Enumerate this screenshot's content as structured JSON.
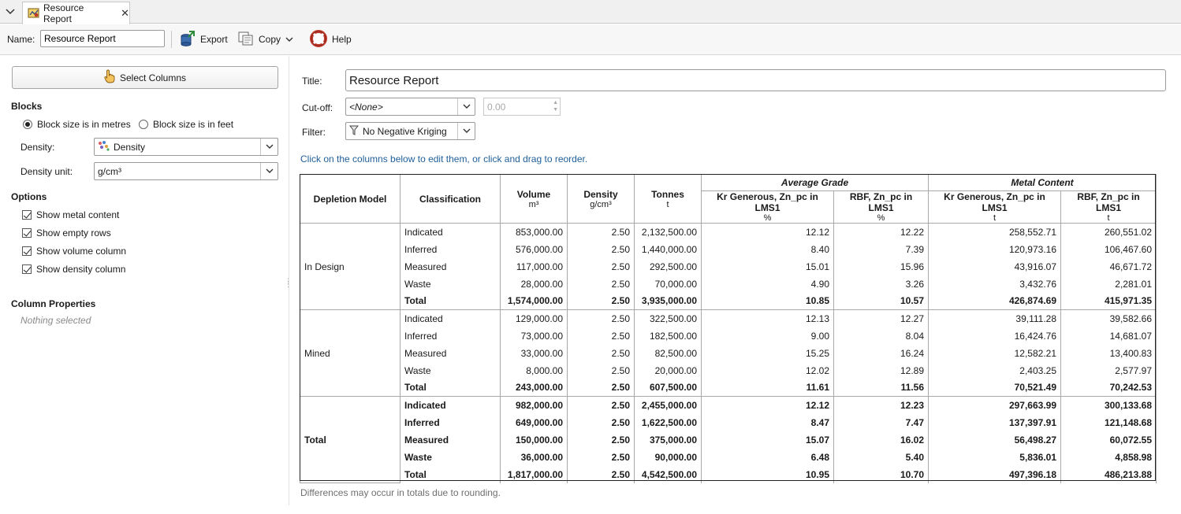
{
  "tab": {
    "label": "Resource Report",
    "close": "✕"
  },
  "toolbar": {
    "name_label": "Name:",
    "name_value": "Resource Report",
    "export_label": "Export",
    "copy_label": "Copy",
    "help_label": "Help"
  },
  "left": {
    "select_columns": "Select Columns",
    "blocks_heading": "Blocks",
    "radio_metres": "Block size is in metres",
    "radio_feet": "Block size is in feet",
    "density_label": "Density:",
    "density_value": "Density",
    "density_unit_label": "Density unit:",
    "density_unit_value": "g/cm³",
    "options_heading": "Options",
    "options": [
      "Show metal content",
      "Show empty rows",
      "Show volume column",
      "Show density column"
    ],
    "column_props_heading": "Column Properties",
    "nothing_selected": "Nothing selected"
  },
  "right": {
    "title_label": "Title:",
    "title_value": "Resource Report",
    "cutoff_label": "Cut-off:",
    "cutoff_value": "<None>",
    "cutoff_number": "0.00",
    "filter_label": "Filter:",
    "filter_value": "No Negative Kriging",
    "hint": "Click on the columns below to edit them, or click and drag to reorder.",
    "footnote": "Differences may occur in totals due to rounding."
  },
  "table": {
    "group_headers": {
      "avg_grade": "Average Grade",
      "metal_content": "Metal Content"
    },
    "columns": [
      {
        "name": "Depletion Model",
        "unit": ""
      },
      {
        "name": "Classification",
        "unit": ""
      },
      {
        "name": "Volume",
        "unit": "m³"
      },
      {
        "name": "Density",
        "unit": "g/cm³"
      },
      {
        "name": "Tonnes",
        "unit": "t"
      },
      {
        "name": "Kr Generous, Zn_pc in LMS1",
        "unit": "%"
      },
      {
        "name": "RBF, Zn_pc in LMS1",
        "unit": "%"
      },
      {
        "name": "Kr Generous, Zn_pc in LMS1",
        "unit": "t"
      },
      {
        "name": "RBF, Zn_pc in LMS1",
        "unit": "t"
      }
    ],
    "groups": [
      {
        "model": "In Design",
        "rows": [
          [
            "Indicated",
            "853,000.00",
            "2.50",
            "2,132,500.00",
            "12.12",
            "12.22",
            "258,552.71",
            "260,551.02"
          ],
          [
            "Inferred",
            "576,000.00",
            "2.50",
            "1,440,000.00",
            "8.40",
            "7.39",
            "120,973.16",
            "106,467.60"
          ],
          [
            "Measured",
            "117,000.00",
            "2.50",
            "292,500.00",
            "15.01",
            "15.96",
            "43,916.07",
            "46,671.72"
          ],
          [
            "Waste",
            "28,000.00",
            "2.50",
            "70,000.00",
            "4.90",
            "3.26",
            "3,432.76",
            "2,281.01"
          ],
          [
            "Total",
            "1,574,000.00",
            "2.50",
            "3,935,000.00",
            "10.85",
            "10.57",
            "426,874.69",
            "415,971.35"
          ]
        ]
      },
      {
        "model": "Mined",
        "rows": [
          [
            "Indicated",
            "129,000.00",
            "2.50",
            "322,500.00",
            "12.13",
            "12.27",
            "39,111.28",
            "39,582.66"
          ],
          [
            "Inferred",
            "73,000.00",
            "2.50",
            "182,500.00",
            "9.00",
            "8.04",
            "16,424.76",
            "14,681.07"
          ],
          [
            "Measured",
            "33,000.00",
            "2.50",
            "82,500.00",
            "15.25",
            "16.24",
            "12,582.21",
            "13,400.83"
          ],
          [
            "Waste",
            "8,000.00",
            "2.50",
            "20,000.00",
            "12.02",
            "12.89",
            "2,403.25",
            "2,577.97"
          ],
          [
            "Total",
            "243,000.00",
            "2.50",
            "607,500.00",
            "11.61",
            "11.56",
            "70,521.49",
            "70,242.53"
          ]
        ]
      },
      {
        "model": "Total",
        "rows": [
          [
            "Indicated",
            "982,000.00",
            "2.50",
            "2,455,000.00",
            "12.12",
            "12.23",
            "297,663.99",
            "300,133.68"
          ],
          [
            "Inferred",
            "649,000.00",
            "2.50",
            "1,622,500.00",
            "8.47",
            "7.47",
            "137,397.91",
            "121,148.68"
          ],
          [
            "Measured",
            "150,000.00",
            "2.50",
            "375,000.00",
            "15.07",
            "16.02",
            "56,498.27",
            "60,072.55"
          ],
          [
            "Waste",
            "36,000.00",
            "2.50",
            "90,000.00",
            "6.48",
            "5.40",
            "5,836.01",
            "4,858.98"
          ],
          [
            "Total",
            "1,817,000.00",
            "2.50",
            "4,542,500.00",
            "10.95",
            "10.70",
            "497,396.18",
            "486,213.88"
          ]
        ]
      }
    ]
  }
}
